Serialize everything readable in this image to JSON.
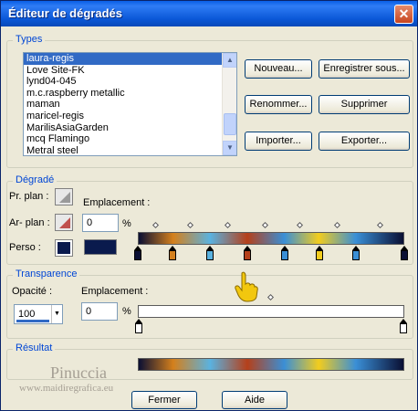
{
  "window": {
    "title": "Éditeur de dégradés",
    "close_symbol": "✕"
  },
  "types": {
    "label": "Types",
    "items": [
      {
        "label": "laura-regis",
        "selected": true
      },
      {
        "label": "Love Site-FK"
      },
      {
        "label": "lynd04-045"
      },
      {
        "label": "m.c.raspberry metallic"
      },
      {
        "label": "maman"
      },
      {
        "label": "maricel-regis"
      },
      {
        "label": "MarilisAsiaGarden"
      },
      {
        "label": "mcq Flamingo"
      },
      {
        "label": "Metral steel"
      }
    ],
    "buttons": {
      "new": "Nouveau...",
      "save_as": "Enregistrer sous...",
      "rename": "Renommer...",
      "delete": "Supprimer",
      "import": "Importer...",
      "export": "Exporter..."
    }
  },
  "gradient": {
    "label": "Dégradé",
    "foreground_label": "Pr. plan :",
    "background_label": "Ar- plan :",
    "custom_label": "Perso :",
    "location_label": "Emplacement :",
    "location_value": "0",
    "percent": "%",
    "custom_color": "#0a1a4d",
    "stops": [
      {
        "pos": 0,
        "color": "#0a0f33"
      },
      {
        "pos": 13,
        "color": "#d4801c"
      },
      {
        "pos": 27,
        "color": "#5ab2e0"
      },
      {
        "pos": 41,
        "color": "#b5401a"
      },
      {
        "pos": 55,
        "color": "#3a8fd6"
      },
      {
        "pos": 68,
        "color": "#f2cc1e"
      },
      {
        "pos": 82,
        "color": "#3a8fd6"
      },
      {
        "pos": 100,
        "color": "#0a0f33"
      }
    ],
    "midpoints": [
      7,
      20,
      34,
      48,
      61,
      75,
      91
    ]
  },
  "transparency": {
    "label": "Transparence",
    "opacity_label": "Opacité :",
    "opacity_value": "100",
    "location_label": "Emplacement :",
    "location_value": "0",
    "percent": "%"
  },
  "result": {
    "label": "Résultat"
  },
  "watermark": {
    "name": "Pinuccia",
    "url": "www.maidiregrafica.eu"
  },
  "footer": {
    "ok": "Fermer",
    "help": "Aide"
  }
}
